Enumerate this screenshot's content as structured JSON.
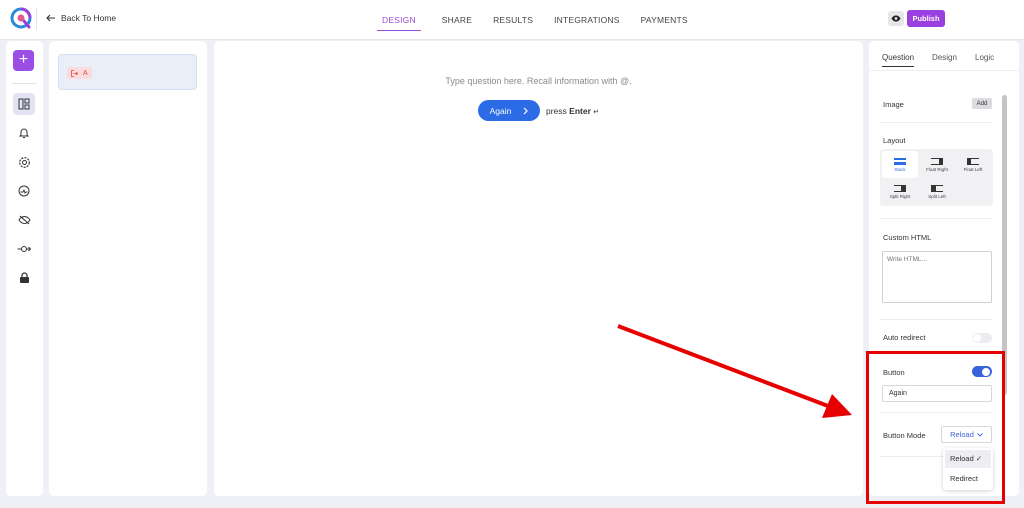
{
  "header": {
    "back_label": "Back To Home",
    "tabs": [
      {
        "label": "DESIGN"
      },
      {
        "label": "SHARE"
      },
      {
        "label": "RESULTS"
      },
      {
        "label": "INTEGRATIONS"
      },
      {
        "label": "PAYMENTS"
      }
    ],
    "publish_label": "Publish"
  },
  "sidebar": {
    "add_label": "+",
    "icons": [
      "layout-icon",
      "bell-icon",
      "gear-icon",
      "speed-icon",
      "eye-off-icon",
      "connection-icon",
      "lock-icon"
    ]
  },
  "question_list": {
    "item_badge": "A"
  },
  "canvas": {
    "prompt": "Type question here. Recall information with @.",
    "button_label": "Again",
    "press_text": "press",
    "enter_text": "Enter",
    "enter_glyph": "↵"
  },
  "settings": {
    "tabs": [
      {
        "label": "Question"
      },
      {
        "label": "Design"
      },
      {
        "label": "Logic"
      }
    ],
    "image_label": "Image",
    "add_label": "Add",
    "layout_label": "Layout",
    "layout_options": [
      {
        "label": "Stack"
      },
      {
        "label": "Float Right"
      },
      {
        "label": "Float Left"
      },
      {
        "label": "Split Right"
      },
      {
        "label": "Split Left"
      }
    ],
    "custom_html_label": "Custom HTML",
    "custom_html_placeholder": "Write HTML...",
    "auto_redirect_label": "Auto redirect",
    "button_label": "Button",
    "button_text_value": "Again",
    "button_mode_label": "Button Mode",
    "button_mode_value": "Reload",
    "button_mode_options": [
      {
        "label": "Reload",
        "selected": true,
        "mark": "✓"
      },
      {
        "label": "Redirect",
        "selected": false
      }
    ]
  },
  "colors": {
    "accent_purple": "#9a3fe0",
    "primary_blue": "#2b6be6",
    "annotation_red": "#e60000"
  }
}
